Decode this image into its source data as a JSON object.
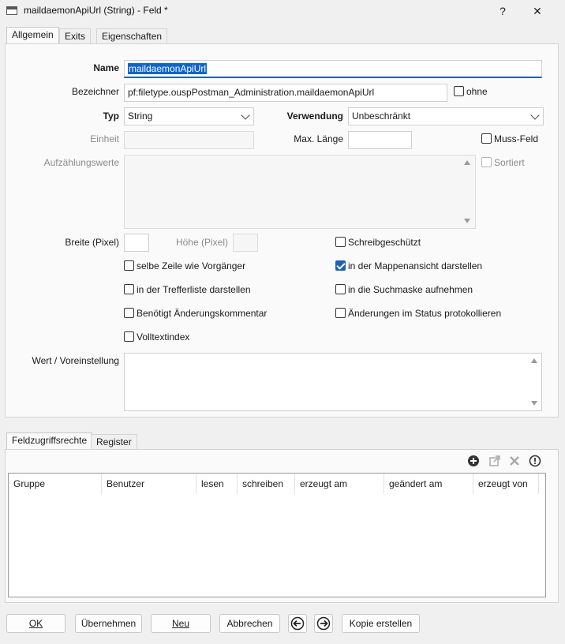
{
  "window": {
    "title": "maildaemonApiUrl (String) - Feld *",
    "help_label": "?",
    "close_label": "✕"
  },
  "tabs": [
    {
      "label": "Allgemein",
      "active": true
    },
    {
      "label": "Exits",
      "active": false
    },
    {
      "label": "Eigenschaften",
      "active": false
    }
  ],
  "form": {
    "name_label": "Name",
    "name_value": "maildaemonApiUrl",
    "bezeichner_label": "Bezeichner",
    "bezeichner_value": "pf:filetype.ouspPostman_Administration.maildaemonApiUrl",
    "ohne_label": "ohne",
    "typ_label": "Typ",
    "typ_value": "String",
    "verwendung_label": "Verwendung",
    "verwendung_value": "Unbeschränkt",
    "einheit_label": "Einheit",
    "einheit_value": "",
    "max_laenge_label": "Max. Länge",
    "max_laenge_value": "",
    "muss_feld_label": "Muss-Feld",
    "aufzaehlungswerte_label": "Aufzählungswerte",
    "sortiert_label": "Sortiert",
    "breite_label": "Breite (Pixel)",
    "breite_value": "",
    "hoehe_label": "Höhe (Pixel)",
    "hoehe_value": "",
    "wert_label": "Wert / Voreinstellung",
    "wert_value": ""
  },
  "checkboxes": {
    "ohne": false,
    "muss_feld": false,
    "sortiert": false,
    "schreibgeschuetzt": {
      "label": "Schreibgeschützt",
      "checked": false
    },
    "selbe_zeile": {
      "label": "selbe Zeile wie Vorgänger",
      "checked": false
    },
    "mappenansicht": {
      "label": "in der Mappenansicht darstellen",
      "checked": true
    },
    "trefferliste": {
      "label": "in der Trefferliste darstellen",
      "checked": false
    },
    "suchmaske": {
      "label": "in die Suchmaske aufnehmen",
      "checked": false
    },
    "aenderungskommentar": {
      "label": "Benötigt Änderungskommentar",
      "checked": false
    },
    "status_protokoll": {
      "label": "Änderungen im Status protokollieren",
      "checked": false
    },
    "volltextindex": {
      "label": "Volltextindex",
      "checked": false
    }
  },
  "bottom_tabs": [
    {
      "label": "Feldzugriffsrechte",
      "active": true
    },
    {
      "label": "Register",
      "active": false
    }
  ],
  "toolbar_icons": [
    "add-icon",
    "open-external-icon",
    "delete-icon",
    "warning-icon"
  ],
  "table": {
    "columns": [
      "Gruppe",
      "Benutzer",
      "lesen",
      "schreiben",
      "erzeugt am",
      "geändert am",
      "erzeugt von"
    ],
    "rows": []
  },
  "buttons": {
    "ok": "OK",
    "uebernehmen": "Übernehmen",
    "neu": "Neu",
    "abbrechen": "Abbrechen",
    "prev": "◀",
    "next": "▶",
    "kopie": "Kopie erstellen"
  },
  "colors": {
    "accent": "#1c62b9",
    "selection": "#0a64d4"
  }
}
